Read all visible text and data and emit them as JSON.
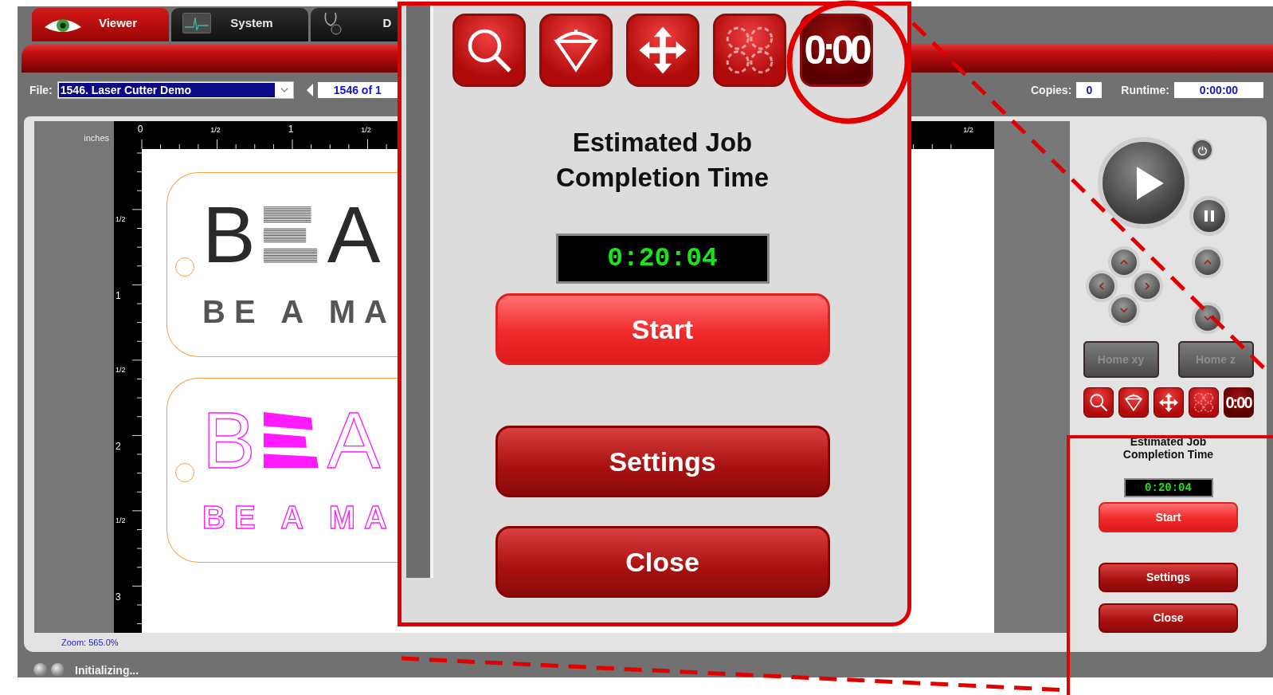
{
  "tabs": [
    {
      "label": "Viewer",
      "selected": true
    },
    {
      "label": "System",
      "selected": false
    },
    {
      "label": "D",
      "selected": false
    }
  ],
  "file": {
    "label": "File:",
    "value": "1546. Laser Cutter Demo"
  },
  "record_counter": "1546 of 1",
  "copies": {
    "label": "Copies:",
    "value": "0"
  },
  "runtime": {
    "label": "Runtime:",
    "value": "0:00:00"
  },
  "ruler": {
    "unit": "inches",
    "top_labels": [
      "0",
      "1/2",
      "1",
      "1/2"
    ],
    "top_right_label": "1/2",
    "side_labels": [
      "1/2",
      "1",
      "1/2",
      "2",
      "1/2",
      "3"
    ]
  },
  "designs": [
    {
      "letter_left": "B",
      "letter_right": "A",
      "tagline": "BE A MA"
    },
    {
      "letter_left": "B",
      "letter_right": "A",
      "tagline": "BE A MA"
    }
  ],
  "zoom": "Zoom:  565.0%",
  "status": "Initializing...",
  "control_panel": {
    "home_buttons": [
      {
        "label": "Home xy",
        "disabled": true
      },
      {
        "label": "Home z",
        "disabled": true
      }
    ],
    "tools": [
      {
        "kind": "magnifier",
        "selected": false
      },
      {
        "kind": "cone",
        "selected": false
      },
      {
        "kind": "move",
        "selected": false
      },
      {
        "kind": "circles",
        "selected": false
      },
      {
        "kind": "timer",
        "text": "0:00",
        "selected": true
      }
    ],
    "title": "Estimated Job Completion Time",
    "time": "0:20:04",
    "buttons": [
      {
        "label": "Start",
        "kind": "primary"
      },
      {
        "label": "Settings",
        "kind": "secondary"
      },
      {
        "label": "Close",
        "kind": "secondary"
      }
    ]
  },
  "callout": {
    "tools": [
      {
        "kind": "magnifier",
        "selected": false
      },
      {
        "kind": "cone",
        "selected": false
      },
      {
        "kind": "move",
        "selected": false
      },
      {
        "kind": "circles",
        "selected": false
      },
      {
        "kind": "timer",
        "text": "0:00",
        "selected": true
      }
    ],
    "title_lines": [
      "Estimated Job",
      "Completion Time"
    ],
    "time": "0:20:04",
    "buttons": [
      {
        "label": "Start",
        "kind": "primary"
      },
      {
        "label": "Settings",
        "kind": "secondary"
      },
      {
        "label": "Close",
        "kind": "secondary"
      }
    ]
  }
}
